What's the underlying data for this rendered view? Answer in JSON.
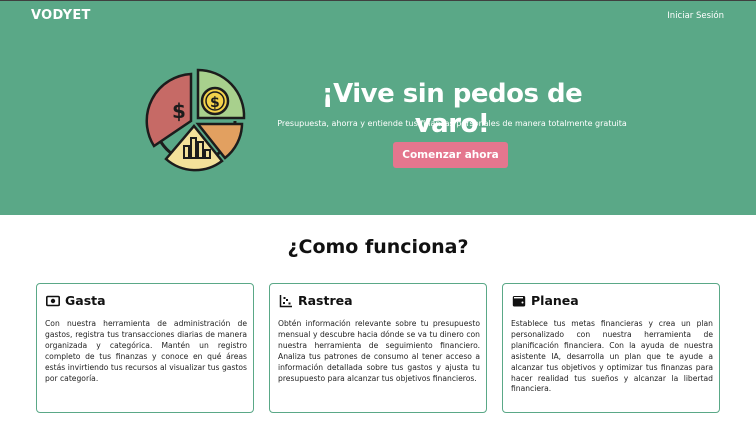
{
  "header": {
    "brand": "VODYET",
    "login_label": "Iniciar Sesión"
  },
  "hero": {
    "logo_icon": "budget-pie-chart-icon",
    "headline": "¡Vive sin pedos de varo!",
    "subtitle": "Presupuesta, ahorra y entiende tus finanzas personales de manera totalmente gratuita",
    "cta_label": "Comenzar ahora"
  },
  "how_it_works": {
    "title": "¿Como funciona?",
    "cards": [
      {
        "icon": "money-bill-icon",
        "title": "Gasta",
        "text": "Con nuestra herramienta de administración de gastos, registra tus transacciones diarias de manera organizada y categórica. Mantén un registro completo de tus finanzas y conoce en qué áreas estás invirtiendo tus recursos al visualizar tus gastos por categoría."
      },
      {
        "icon": "scatter-chart-icon",
        "title": "Rastrea",
        "text": "Obtén información relevante sobre tu presupuesto mensual y descubre hacia dónde se va tu dinero con nuestra herramienta de seguimiento financiero. Analiza tus patrones de consumo al tener acceso a información detallada sobre tus gastos y ajusta tu presupuesto para alcanzar tus objetivos financieros."
      },
      {
        "icon": "wallet-icon",
        "title": "Planea",
        "text": "Establece tus metas financieras y crea un plan personalizado con nuestra herramienta de planificación financiera. Con la ayuda de nuestra asistente IA, desarrolla un plan que te ayude a alcanzar tus objetivos y optimizar tus finanzas para hacer realidad tus sueños y alcanzar la libertad financiera."
      }
    ]
  },
  "colors": {
    "hero_background": "#5aa887",
    "cta_background": "#e4768e",
    "card_border": "#5aa887"
  }
}
